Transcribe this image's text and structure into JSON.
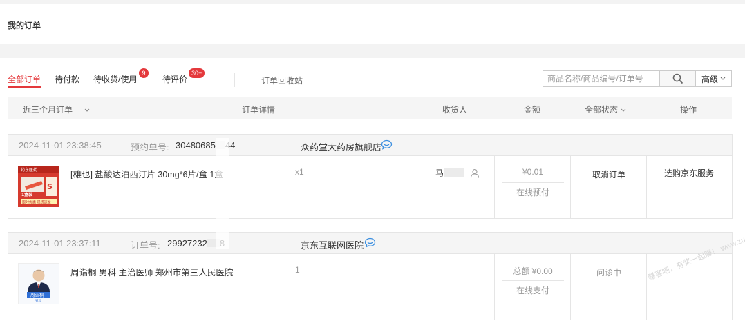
{
  "page": {
    "title": "我的订单"
  },
  "tabs": [
    {
      "label": "全部订单",
      "active": true
    },
    {
      "label": "待付款"
    },
    {
      "label": "待收货/使用",
      "badge": "9"
    },
    {
      "label": "待评价",
      "badge": "30+"
    }
  ],
  "recycle_bin": "订单回收站",
  "search": {
    "placeholder": "商品名称/商品编号/订单号",
    "advanced_label": "高级"
  },
  "table_header": {
    "period": "近三个月订单",
    "details": "订单详情",
    "consignee": "收货人",
    "amount": "金额",
    "status": "全部状态",
    "actions": "操作"
  },
  "orders": [
    {
      "datetime": "2024-11-01 23:38:45",
      "number_label": "预约单号:",
      "number": "30480685",
      "number_tail": "44",
      "shop": "众药堂大药房旗舰店",
      "product": "[雄也] 盐酸达泊西汀片 30mg*6片/盒 1盒",
      "quantity": "x1",
      "consignee_initial": "马",
      "amount": "¥0.01",
      "payment": "在线预付",
      "status": "取消订单",
      "action": "选购京东服务",
      "thumb_text": {
        "brand": "药东医药",
        "box": "1盒装",
        "promo": "限时优惠 现货速发"
      }
    },
    {
      "datetime": "2024-11-01 23:37:11",
      "number_label": "订单号:",
      "number": "29927232",
      "number_tail": "8",
      "shop": "京东互联网医院",
      "product": "周诣桐 男科 主治医师 郑州市第三人民医院",
      "quantity": "1",
      "amount": "总额 ¥0.00",
      "payment": "在线支付",
      "status": "问诊中",
      "thumb_text": {
        "name": "周诣桐",
        "dept": "男科"
      }
    }
  ],
  "watermark": "赚客吧，有奖一起赚！ www.zuanke8.com",
  "colors": {
    "accent": "#e4393c",
    "service_icon": "#3c8fe0"
  }
}
